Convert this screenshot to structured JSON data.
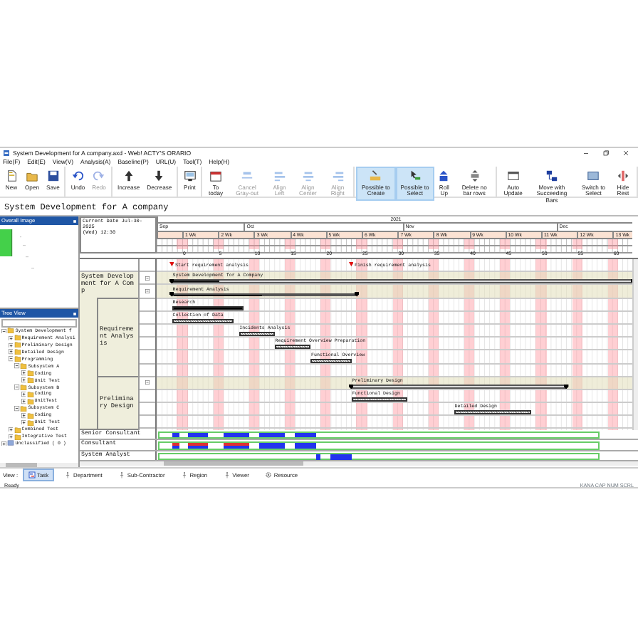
{
  "window": {
    "title": "System Development for A company.axd - Web! ACTY'S ORARIO"
  },
  "menu": [
    "File(F)",
    "Edit(E)",
    "View(V)",
    "Analysis(A)",
    "Baseline(P)",
    "URL(U)",
    "Tool(T)",
    "Help(H)"
  ],
  "toolbar": [
    [
      {
        "label": "New",
        "disabled": false,
        "selected": false
      },
      {
        "label": "Open",
        "disabled": false,
        "selected": false
      },
      {
        "label": "Save",
        "disabled": false,
        "selected": false
      }
    ],
    [
      {
        "label": "Undo",
        "disabled": false,
        "selected": false
      },
      {
        "label": "Redo",
        "disabled": true,
        "selected": false
      }
    ],
    [
      {
        "label": "Increase",
        "disabled": false,
        "selected": false
      },
      {
        "label": "Decrease",
        "disabled": false,
        "selected": false
      }
    ],
    [
      {
        "label": "Print",
        "disabled": false,
        "selected": false
      }
    ],
    [
      {
        "label": "To today",
        "disabled": false,
        "selected": false
      },
      {
        "label": "Cancel Gray-out",
        "disabled": true,
        "selected": false
      },
      {
        "label": "Align Left",
        "disabled": true,
        "selected": false
      },
      {
        "label": "Align Center",
        "disabled": true,
        "selected": false
      },
      {
        "label": "Align Right",
        "disabled": true,
        "selected": false
      }
    ],
    [
      {
        "label": "Possible to Create",
        "disabled": false,
        "selected": true
      },
      {
        "label": "Possible to Select",
        "disabled": false,
        "selected": true
      },
      {
        "label": "Roll Up",
        "disabled": false,
        "selected": false
      },
      {
        "label": "Delete no bar rows",
        "disabled": false,
        "selected": false
      }
    ],
    [
      {
        "label": "Auto Update",
        "disabled": false,
        "selected": false
      },
      {
        "label": "Move with Succeeding Bars",
        "disabled": false,
        "selected": false
      },
      {
        "label": "Switch to Select",
        "disabled": false,
        "selected": false
      },
      {
        "label": "Hide Rest",
        "disabled": false,
        "selected": false
      }
    ]
  ],
  "document_title": "System Development for A company",
  "overall_image": {
    "title": "Overall Image"
  },
  "tree_view": {
    "title": "Tree View",
    "items": [
      {
        "kind": "folder",
        "label": "System Development f",
        "expanded": true,
        "children": [
          {
            "label": "Requirement Analysi",
            "expanded": false
          },
          {
            "label": "Preliminary Design",
            "expanded": false
          },
          {
            "label": "Detailed Design",
            "expanded": false
          },
          {
            "label": "Programming",
            "expanded": true,
            "children": [
              {
                "label": "Subsystem A",
                "expanded": true,
                "children": [
                  {
                    "label": "Coding",
                    "expanded": false
                  },
                  {
                    "label": "Unit Test",
                    "expanded": false
                  }
                ]
              },
              {
                "label": "Subsystem B",
                "expanded": true,
                "children": [
                  {
                    "label": "Coding",
                    "expanded": false
                  },
                  {
                    "label": "UnitTest",
                    "expanded": false
                  }
                ]
              },
              {
                "label": "Subsystem C",
                "expanded": true,
                "children": [
                  {
                    "label": "Coding",
                    "expanded": false
                  },
                  {
                    "label": "Unit Test",
                    "expanded": false
                  }
                ]
              }
            ]
          },
          {
            "label": "Combined Test",
            "expanded": false
          },
          {
            "label": "Integrative Test",
            "expanded": false
          }
        ]
      },
      {
        "kind": "unclassified",
        "label": "Unclassified ( 0 )",
        "expanded": false
      }
    ]
  },
  "gantt": {
    "current_date": "Current Date Jul-30-2025",
    "current_time": "(Wed) 12:30",
    "year": "2021",
    "months": [
      "Sep",
      "Oct",
      "Nov",
      "Dec"
    ],
    "weeks": [
      {
        "label": "1 Wk",
        "count": "0"
      },
      {
        "label": "2 Wk",
        "count": "5"
      },
      {
        "label": "3 Wk",
        "count": "10"
      },
      {
        "label": "4 Wk",
        "count": "15"
      },
      {
        "label": "5 Wk",
        "count": "20"
      },
      {
        "label": "6 Wk",
        "count": "25"
      },
      {
        "label": "7 Wk",
        "count": "30"
      },
      {
        "label": "8 Wk",
        "count": "35"
      },
      {
        "label": "9 Wk",
        "count": "40"
      },
      {
        "label": "10 Wk",
        "count": "45"
      },
      {
        "label": "11 Wk",
        "count": "50"
      },
      {
        "label": "12 Wk",
        "count": "55"
      },
      {
        "label": "13 Wk",
        "count": "60"
      }
    ],
    "milestones": [
      {
        "label": "Start requirement analysis"
      },
      {
        "label": "Finish requirement analysis"
      }
    ],
    "groups": [
      {
        "label": "System Development for A Comp",
        "rows": [
          {
            "kind": "summary",
            "label": "System Development for A Company",
            "level": 0.1
          },
          {
            "kind": "summary",
            "label": "Requirement Analysis",
            "level": 0.49
          }
        ],
        "subgroups": [
          {
            "label": "Requirement Analysis",
            "rows": [
              {
                "kind": "task",
                "label": "Research",
                "level": 1
              },
              {
                "kind": "task",
                "label": "Collection of Data",
                "level": 0
              },
              {
                "kind": "task",
                "label": "Incidents Analysis",
                "level": 0
              },
              {
                "kind": "task",
                "label": "Requirement Overview Preparation",
                "level": 0
              },
              {
                "kind": "task",
                "label": "Functional Overview",
                "level": 0
              },
              {
                "kind": "blank"
              }
            ]
          },
          {
            "label": "Preliminary Design",
            "rows": [
              {
                "kind": "summary",
                "label": "Preliminary Design",
                "level": 0
              },
              {
                "kind": "task",
                "label": "Functional Design",
                "level": 0
              },
              {
                "kind": "task",
                "label": "Detailed Design",
                "level": 0
              },
              {
                "kind": "blank"
              }
            ]
          }
        ]
      }
    ],
    "resources": [
      {
        "label": "Senior Consultant"
      },
      {
        "label": "Consultant"
      },
      {
        "label": "System Analyst"
      }
    ]
  },
  "view_tabs": {
    "label": "View :",
    "tabs": [
      {
        "label": "Task",
        "selected": true
      },
      {
        "label": "Department",
        "selected": false
      },
      {
        "label": "Sub-Contractor",
        "selected": false
      },
      {
        "label": "Region",
        "selected": false
      },
      {
        "label": "Viewer",
        "selected": false
      },
      {
        "label": "Resource",
        "selected": false
      }
    ]
  },
  "status_bar": {
    "left": "Ready",
    "right": "KANA CAP NUM SCRL"
  }
}
